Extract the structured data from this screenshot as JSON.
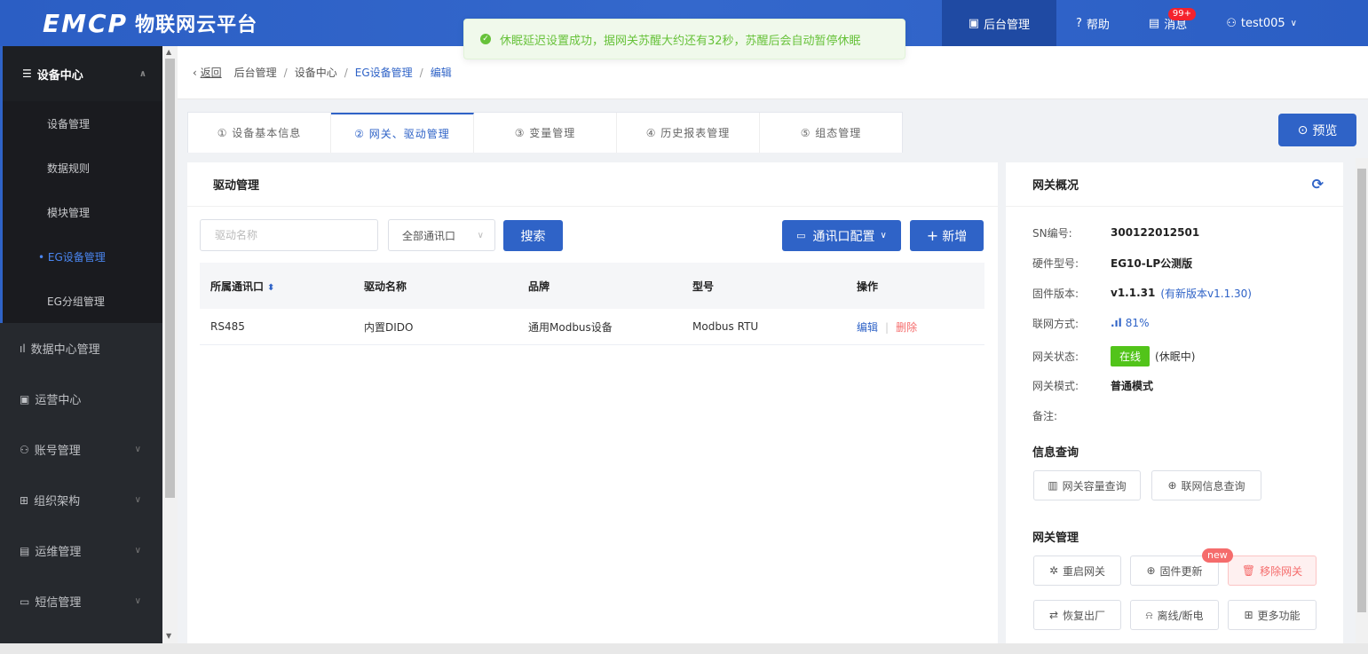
{
  "header": {
    "logo_mark": "EMCP",
    "logo_text": "物联网云平台",
    "items": [
      {
        "label": "后台管理",
        "icon": "monitor-icon"
      },
      {
        "label": "帮助",
        "icon": "help-icon"
      },
      {
        "label": "消息",
        "icon": "message-icon",
        "badge": "99+"
      },
      {
        "label": "test005",
        "icon": "user-icon"
      }
    ]
  },
  "toast": {
    "text": "休眠延迟设置成功，据网关苏醒大约还有32秒，苏醒后会自动暂停休眠"
  },
  "sidebar": {
    "group": {
      "label": "设备中心",
      "icon": "device-icon"
    },
    "subitems": [
      {
        "label": "设备管理"
      },
      {
        "label": "数据规则"
      },
      {
        "label": "模块管理"
      },
      {
        "label": "• EG设备管理"
      },
      {
        "label": "EG分组管理"
      }
    ],
    "items": [
      {
        "label": "数据中心管理",
        "icon": "chart-icon"
      },
      {
        "label": "运营中心",
        "icon": "operation-icon"
      },
      {
        "label": "账号管理",
        "icon": "account-icon"
      },
      {
        "label": "组织架构",
        "icon": "org-icon"
      },
      {
        "label": "运维管理",
        "icon": "maintenance-icon"
      },
      {
        "label": "短信管理",
        "icon": "sms-icon"
      }
    ]
  },
  "breadcrumb": {
    "back": "返回",
    "items": [
      "后台管理",
      "设备中心",
      "EG设备管理",
      "编辑"
    ]
  },
  "tabs": [
    {
      "label": "① 设备基本信息"
    },
    {
      "label": "② 网关、驱动管理"
    },
    {
      "label": "③ 变量管理"
    },
    {
      "label": "④ 历史报表管理"
    },
    {
      "label": "⑤ 组态管理"
    }
  ],
  "preview_label": "预览",
  "driver": {
    "title": "驱动管理",
    "search_placeholder": "驱动名称",
    "port_select": "全部通讯口",
    "search_label": "搜索",
    "port_config_label": "通讯口配置",
    "add_label": "新增",
    "columns": [
      "所属通讯口",
      "驱动名称",
      "品牌",
      "型号",
      "操作"
    ],
    "rows": [
      {
        "port": "RS485",
        "name": "内置DIDO",
        "brand": "通用Modbus设备",
        "model": "Modbus RTU",
        "edit": "编辑",
        "delete": "删除"
      }
    ]
  },
  "gateway": {
    "title": "网关概况",
    "sn_label": "SN编号:",
    "sn": "300122012501",
    "hw_label": "硬件型号:",
    "hw": "EG10-LP公测版",
    "fw_label": "固件版本:",
    "fw": "v1.1.31",
    "fw_new": "(有新版本v1.1.30)",
    "net_label": "联网方式:",
    "net": "81%",
    "status_label": "网关状态:",
    "status": "在线",
    "status_note": "(休眠中)",
    "mode_label": "网关模式:",
    "mode": "普通模式",
    "remark_label": "备注:",
    "info_title": "信息查询",
    "capacity_btn": "网关容量查询",
    "netinfo_btn": "联网信息查询",
    "manage_title": "网关管理",
    "restart_btn": "重启网关",
    "firmware_btn": "固件更新",
    "new_badge": "new",
    "remove_btn": "移除网关",
    "factory_btn": "恢复出厂",
    "offline_btn": "离线/断电",
    "more_btn": "更多功能"
  }
}
